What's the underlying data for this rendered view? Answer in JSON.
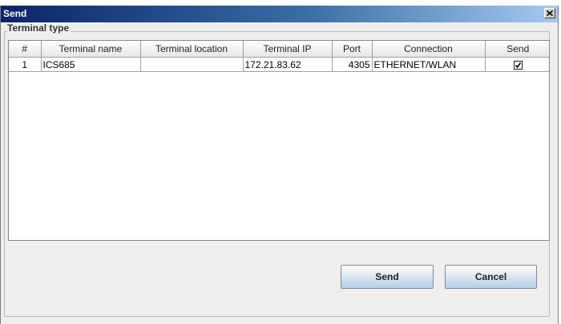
{
  "window": {
    "title": "Send"
  },
  "group": {
    "label": "Terminal type"
  },
  "table": {
    "columns": [
      "#",
      "Terminal name",
      "Terminal location",
      "Terminal IP",
      "Port",
      "Connection",
      "Send"
    ],
    "rows": [
      {
        "index": "1",
        "name": "ICS685",
        "location": "",
        "ip": "172.21.83.62",
        "port": "4305",
        "connection": "ETHERNET/WLAN",
        "send": true
      }
    ]
  },
  "buttons": {
    "send": "Send",
    "cancel": "Cancel"
  },
  "icons": {
    "close": "close-icon",
    "check": "check-icon"
  }
}
